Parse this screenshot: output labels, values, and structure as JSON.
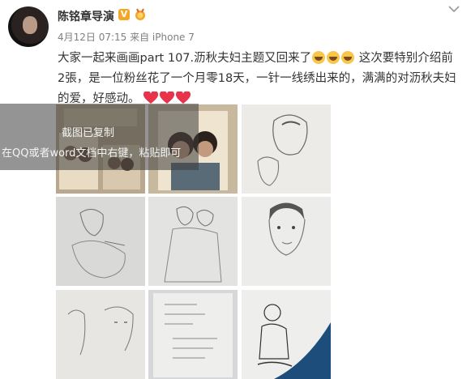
{
  "post": {
    "author": "陈铭章导演",
    "vip_badge": "V",
    "meta": "4月12日 07:15 来自 iPhone 7",
    "text_part1": "大家一起来画画part 107.沥秋夫妇主题又回来了",
    "text_part2": "这次要特别介绍前2張，是一位粉丝花了一个月零18天，一针一线绣出来的，满满的对沥秋夫妇的爱，好感动。"
  },
  "overlay": {
    "title": "截图已复制",
    "hint": "在QQ或者word文档中右键，粘贴即可"
  },
  "thumbs": [
    {
      "name": "embroidery-collage-1"
    },
    {
      "name": "embroidery-couple-2"
    },
    {
      "name": "sketch-couple-3"
    },
    {
      "name": "sketch-man-reading-4"
    },
    {
      "name": "sketch-couple-dancing-5"
    },
    {
      "name": "sketch-man-portrait-6"
    },
    {
      "name": "sketch-couple-lines-7"
    },
    {
      "name": "sketch-notes-8"
    },
    {
      "name": "drawing-signed-9"
    }
  ],
  "colors": {
    "vip": "#f5a623",
    "heart": "#e8334a",
    "text": "#333333",
    "meta": "#808080"
  }
}
